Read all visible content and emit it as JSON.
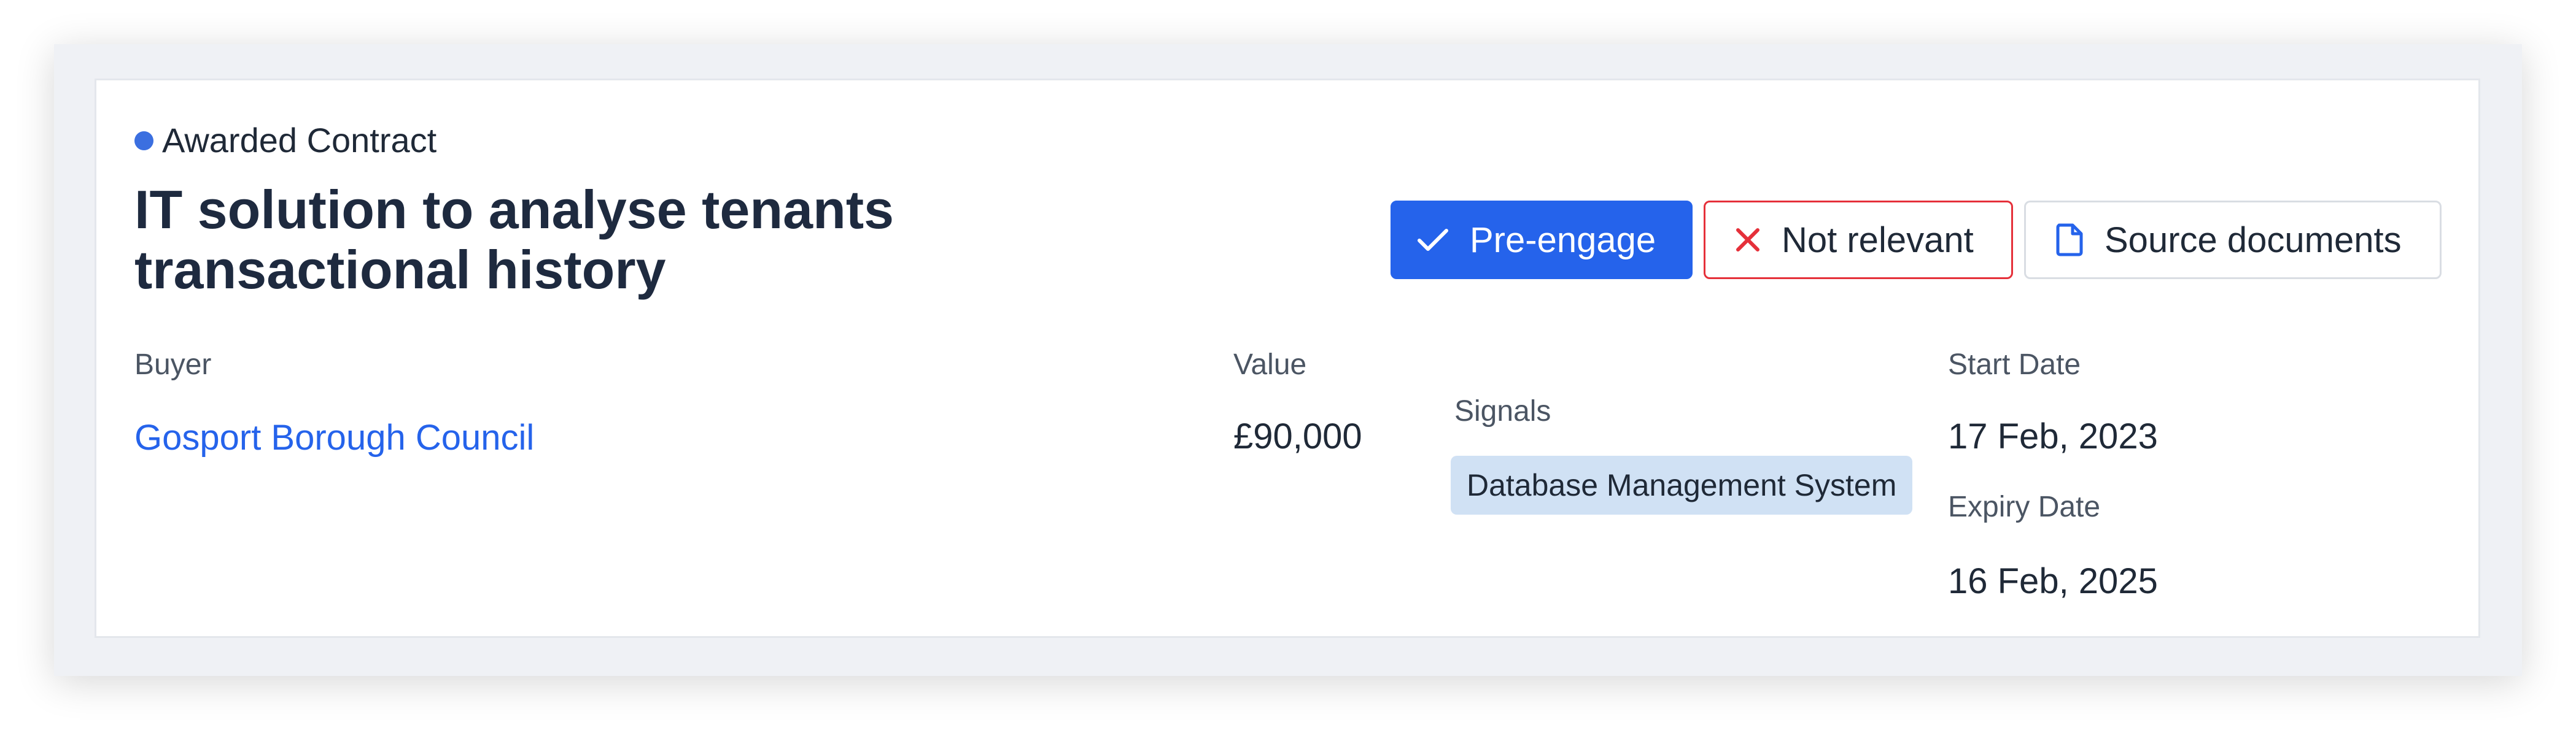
{
  "contract": {
    "status": "Awarded Contract",
    "title": "IT solution to analyse tenants transactional history"
  },
  "actions": {
    "pre_engage": "Pre-engage",
    "not_relevant": "Not relevant",
    "source_documents": "Source documents"
  },
  "details": {
    "buyer_label": "Buyer",
    "buyer_name": "Gosport Borough Council",
    "value_label": "Value",
    "value": "£90,000",
    "signals_label": "Signals",
    "signals": [
      "Database Management System"
    ],
    "start_date_label": "Start Date",
    "start_date": "17 Feb, 2023",
    "expiry_date_label": "Expiry Date",
    "expiry_date": "16 Feb, 2025"
  },
  "colors": {
    "accent": "#2563eb",
    "status_dot": "#3b6fe0",
    "danger": "#e5303a",
    "title": "#1e2a3f",
    "signal_badge": "#d0e1f4"
  },
  "icons": {
    "pre_engage": "check-icon",
    "not_relevant": "close-icon",
    "source_documents": "document-icon"
  }
}
